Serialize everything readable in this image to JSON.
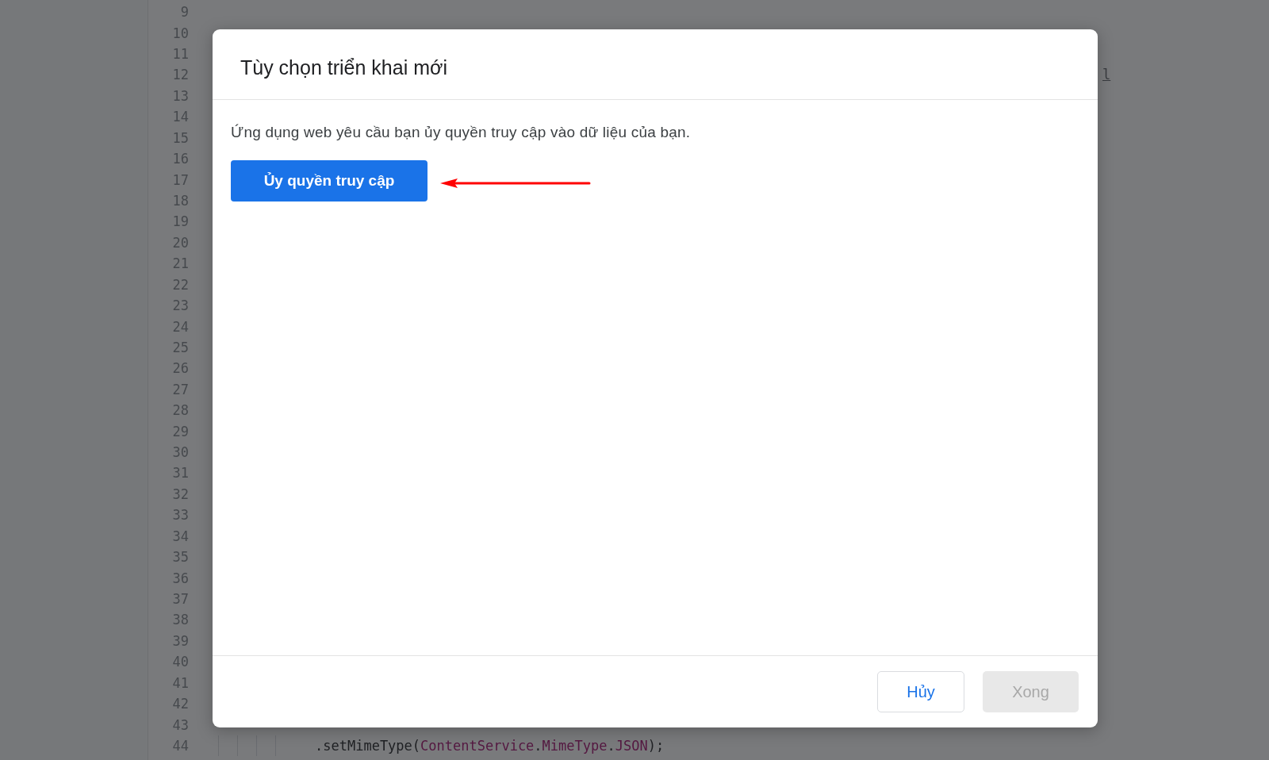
{
  "editor": {
    "lines": [
      {
        "number": "9"
      },
      {
        "number": "10"
      },
      {
        "number": "11"
      },
      {
        "number": "12",
        "code": [
          {
            "kind": "link",
            "text": "l"
          }
        ]
      },
      {
        "number": "13"
      },
      {
        "number": "14"
      },
      {
        "number": "15"
      },
      {
        "number": "16"
      },
      {
        "number": "17"
      },
      {
        "number": "18"
      },
      {
        "number": "19"
      },
      {
        "number": "20"
      },
      {
        "number": "21"
      },
      {
        "number": "22"
      },
      {
        "number": "23"
      },
      {
        "number": "24"
      },
      {
        "number": "25"
      },
      {
        "number": "26"
      },
      {
        "number": "27"
      },
      {
        "number": "28"
      },
      {
        "number": "29"
      },
      {
        "number": "30"
      },
      {
        "number": "31"
      },
      {
        "number": "32"
      },
      {
        "number": "33"
      },
      {
        "number": "34"
      },
      {
        "number": "35"
      },
      {
        "number": "36"
      },
      {
        "number": "37"
      },
      {
        "number": "38"
      },
      {
        "number": "39"
      },
      {
        "number": "40"
      },
      {
        "number": "41"
      },
      {
        "number": "42"
      },
      {
        "number": "43"
      },
      {
        "number": "44",
        "code": [
          {
            "kind": "plain",
            "text": ".setMimeType("
          },
          {
            "kind": "ident",
            "text": "ContentService"
          },
          {
            "kind": "plain",
            "text": "."
          },
          {
            "kind": "ident",
            "text": "MimeType"
          },
          {
            "kind": "plain",
            "text": "."
          },
          {
            "kind": "ident",
            "text": "JSON"
          },
          {
            "kind": "plain",
            "text": ");"
          }
        ]
      }
    ]
  },
  "dialog": {
    "title": "Tùy chọn triển khai mới",
    "message": "Ứng dụng web yêu cầu bạn ủy quyền truy cập vào dữ liệu của bạn.",
    "authorize_button": "Ủy quyền truy cập",
    "buttons": [
      {
        "label": "Hủy",
        "disabled": false
      },
      {
        "label": "Xong",
        "disabled": true
      }
    ]
  }
}
